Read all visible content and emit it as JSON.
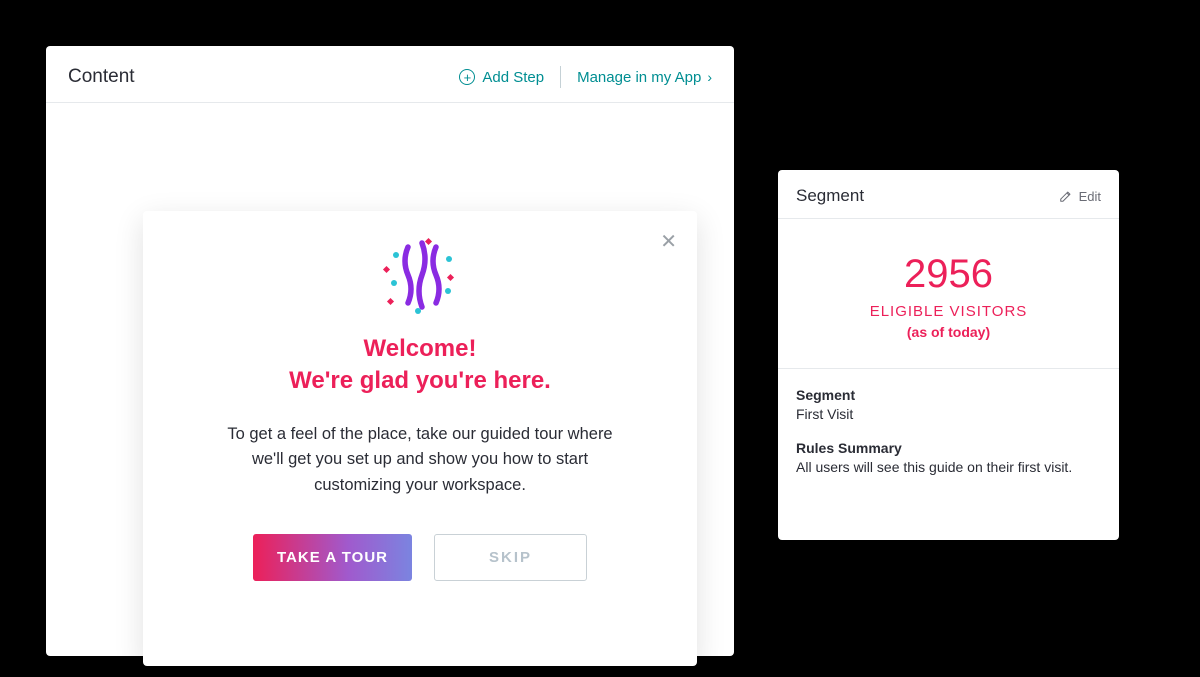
{
  "content_panel": {
    "title": "Content",
    "add_step_label": "Add Step",
    "manage_link_label": "Manage in my App"
  },
  "welcome_card": {
    "heading_line1": "Welcome!",
    "heading_line2": "We're glad you're here.",
    "body": "To get a feel of the place, take our guided tour where we'll get you set up and show you how to start customizing your workspace.",
    "tour_button": "TAKE A TOUR",
    "skip_button": "SKIP"
  },
  "segment_panel": {
    "title": "Segment",
    "edit_label": "Edit",
    "count": "2956",
    "count_label": "ELIGIBLE VISITORS",
    "as_of": "(as of today)",
    "segment_label": "Segment",
    "segment_value": "First Visit",
    "rules_label": "Rules Summary",
    "rules_value": "All users will see this guide on their first visit."
  },
  "colors": {
    "accent_pink": "#ec2059",
    "accent_teal": "#008e92",
    "accent_purple": "#a05acd"
  }
}
